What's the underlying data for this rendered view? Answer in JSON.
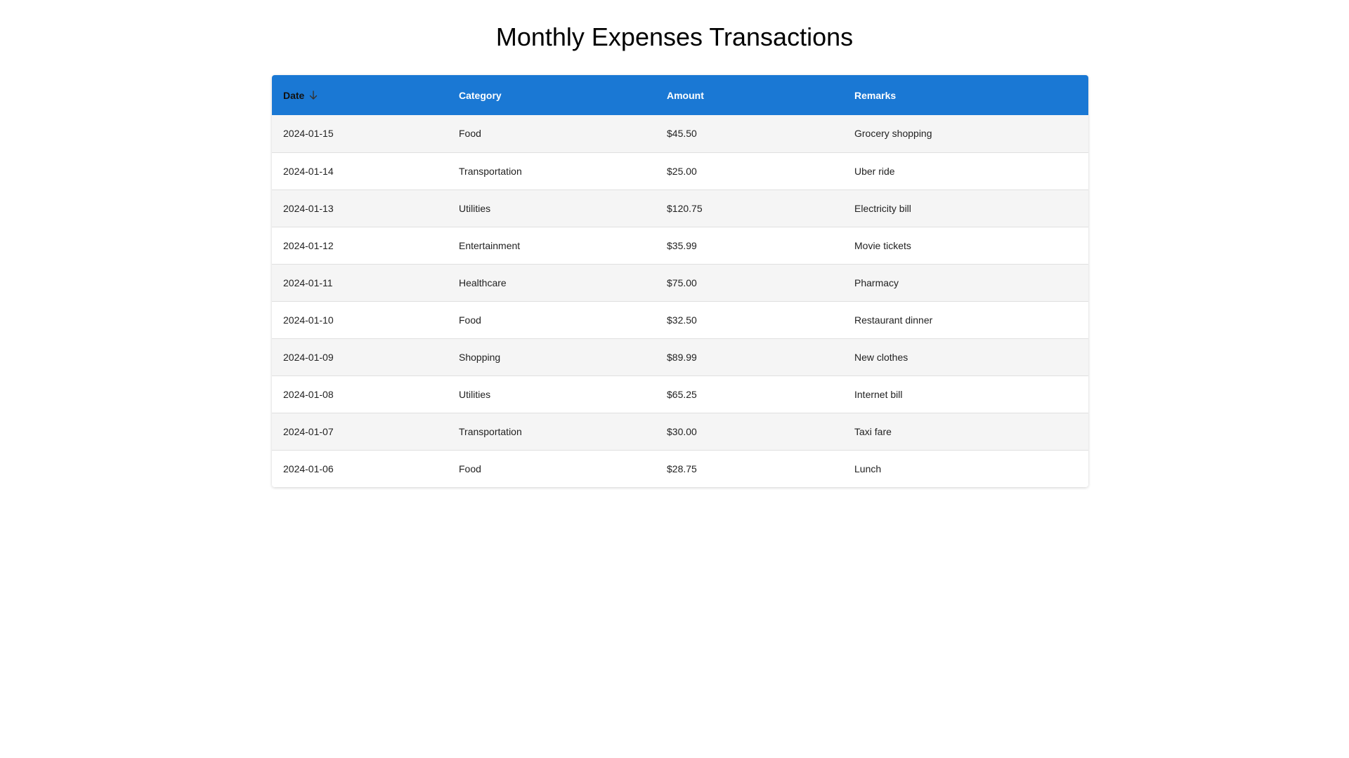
{
  "page": {
    "title": "Monthly Expenses Transactions"
  },
  "colors": {
    "header_bg": "#1a78d4",
    "header_text": "#ffffff",
    "sorted_header_text": "#111111",
    "row_alt_bg": "#f5f5f5"
  },
  "table": {
    "columns": [
      {
        "key": "date",
        "label": "Date",
        "sorted": "descending",
        "sort_icon": "arrow-down-icon"
      },
      {
        "key": "category",
        "label": "Category"
      },
      {
        "key": "amount",
        "label": "Amount"
      },
      {
        "key": "remarks",
        "label": "Remarks"
      }
    ],
    "rows": [
      {
        "date": "2024-01-15",
        "category": "Food",
        "amount": "$45.50",
        "remarks": "Grocery shopping"
      },
      {
        "date": "2024-01-14",
        "category": "Transportation",
        "amount": "$25.00",
        "remarks": "Uber ride"
      },
      {
        "date": "2024-01-13",
        "category": "Utilities",
        "amount": "$120.75",
        "remarks": "Electricity bill"
      },
      {
        "date": "2024-01-12",
        "category": "Entertainment",
        "amount": "$35.99",
        "remarks": "Movie tickets"
      },
      {
        "date": "2024-01-11",
        "category": "Healthcare",
        "amount": "$75.00",
        "remarks": "Pharmacy"
      },
      {
        "date": "2024-01-10",
        "category": "Food",
        "amount": "$32.50",
        "remarks": "Restaurant dinner"
      },
      {
        "date": "2024-01-09",
        "category": "Shopping",
        "amount": "$89.99",
        "remarks": "New clothes"
      },
      {
        "date": "2024-01-08",
        "category": "Utilities",
        "amount": "$65.25",
        "remarks": "Internet bill"
      },
      {
        "date": "2024-01-07",
        "category": "Transportation",
        "amount": "$30.00",
        "remarks": "Taxi fare"
      },
      {
        "date": "2024-01-06",
        "category": "Food",
        "amount": "$28.75",
        "remarks": "Lunch"
      }
    ]
  }
}
